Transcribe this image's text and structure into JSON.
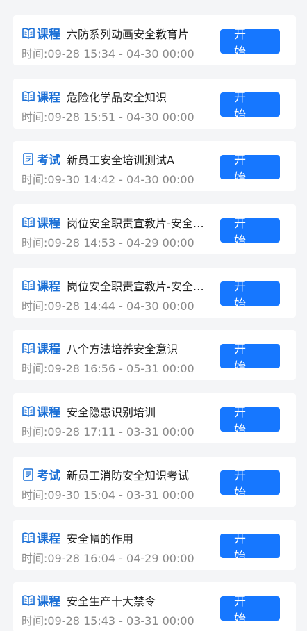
{
  "start_label": "开 始",
  "items": [
    {
      "type": "course",
      "type_label": "课程",
      "title": "六防系列动画安全教育片",
      "time": "时间:09-28 15:34 - 04-30 00:00"
    },
    {
      "type": "course",
      "type_label": "课程",
      "title": "危险化学品安全知识",
      "time": "时间:09-28 15:51 - 04-30 00:00"
    },
    {
      "type": "exam",
      "type_label": "考试",
      "title": "新员工安全培训测试A",
      "time": "时间:09-30 14:42 - 04-30 00:00"
    },
    {
      "type": "course",
      "type_label": "课程",
      "title": "岗位安全职责宣教片-安全…",
      "time": "时间:09-28 14:53 - 04-29 00:00"
    },
    {
      "type": "course",
      "type_label": "课程",
      "title": "岗位安全职责宣教片-安全…",
      "time": "时间:09-28 14:44 - 04-30 00:00"
    },
    {
      "type": "course",
      "type_label": "课程",
      "title": "八个方法培养安全意识",
      "time": "时间:09-28 16:56 - 05-31 00:00"
    },
    {
      "type": "course",
      "type_label": "课程",
      "title": "安全隐患识别培训",
      "time": "时间:09-28 17:11 - 03-31 00:00"
    },
    {
      "type": "exam",
      "type_label": "考试",
      "title": "新员工消防安全知识考试",
      "time": "时间:09-30 15:04 - 03-31 00:00"
    },
    {
      "type": "course",
      "type_label": "课程",
      "title": "安全帽的作用",
      "time": "时间:09-28 16:04 - 04-29 00:00"
    },
    {
      "type": "course",
      "type_label": "课程",
      "title": "安全生产十大禁令",
      "time": "时间:09-28 15:43 - 03-31 00:00"
    }
  ],
  "colors": {
    "accent": "#1677ff",
    "tag": "#1a6fd6",
    "background": "#f4f5f7",
    "time_text": "#8a8a8a"
  },
  "icons": {
    "course": "open-book-icon",
    "exam": "exam-paper-icon"
  }
}
